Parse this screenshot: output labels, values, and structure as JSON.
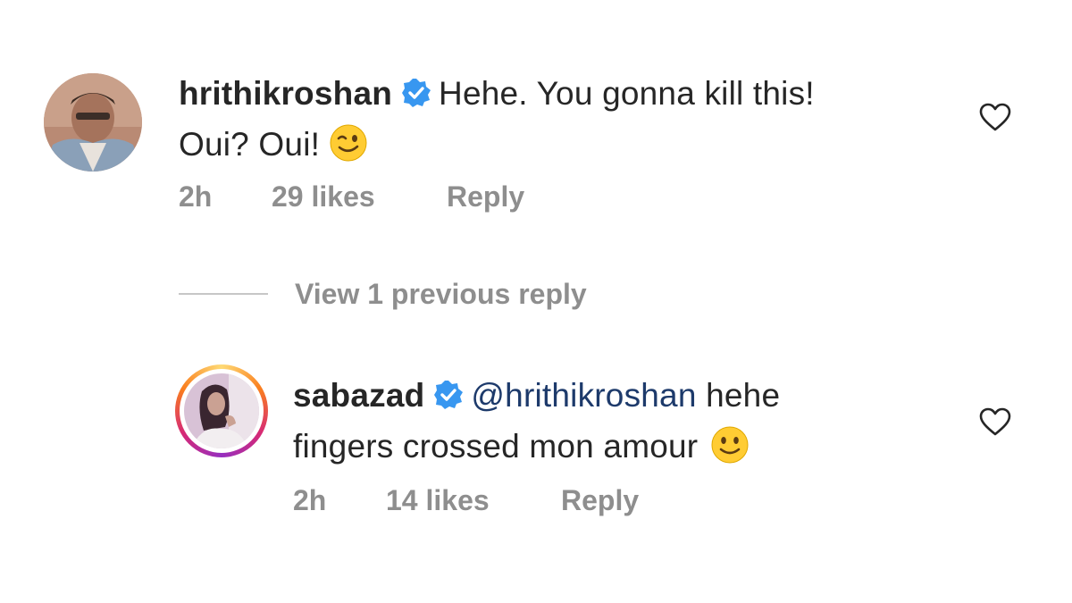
{
  "comments": [
    {
      "username": "hrithikroshan",
      "text_line1": "Hehe. You gonna kill this!",
      "text_line2": "Oui? Oui!",
      "emoji": "winking-face-emoji",
      "time": "2h",
      "likes": "29 likes",
      "reply_label": "Reply",
      "verified": true
    },
    {
      "username": "sabazad",
      "mention": "@hrithikroshan",
      "text_line1": "hehe",
      "text_line2": "fingers crossed mon amour",
      "emoji": "slightly-smiling-face-emoji",
      "time": "2h",
      "likes": "14 likes",
      "reply_label": "Reply",
      "verified": true,
      "story_ring": true
    }
  ],
  "view_replies": "View 1 previous reply",
  "colors": {
    "verified": "#3897f0",
    "meta_text": "#8e8e8e",
    "mention": "#1d3a6b",
    "heart_stroke": "#262626"
  },
  "icons": [
    "verified-badge-icon",
    "heart-icon"
  ]
}
